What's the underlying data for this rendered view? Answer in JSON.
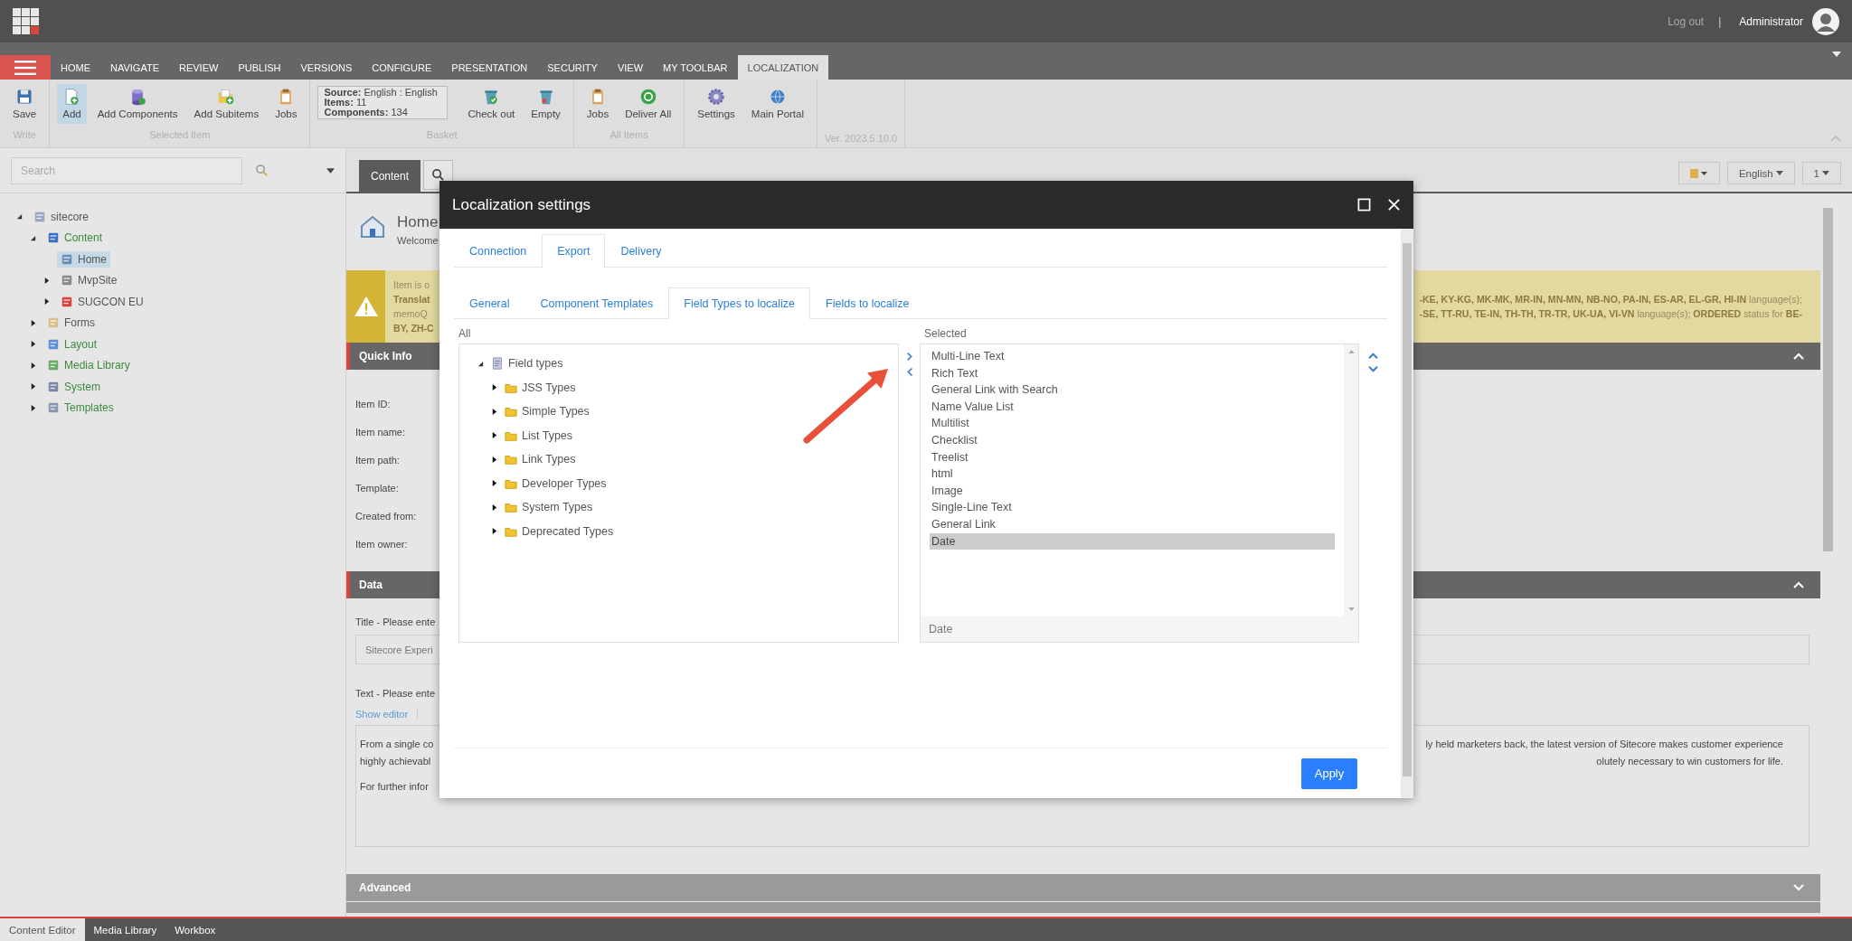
{
  "top_bar": {
    "log_out": "Log out",
    "separator": "|",
    "user": "Administrator"
  },
  "ribbon_tabs": [
    {
      "label": "HOME",
      "selected": false
    },
    {
      "label": "NAVIGATE",
      "selected": false
    },
    {
      "label": "REVIEW",
      "selected": false
    },
    {
      "label": "PUBLISH",
      "selected": false
    },
    {
      "label": "VERSIONS",
      "selected": false
    },
    {
      "label": "CONFIGURE",
      "selected": false
    },
    {
      "label": "PRESENTATION",
      "selected": false
    },
    {
      "label": "SECURITY",
      "selected": false
    },
    {
      "label": "VIEW",
      "selected": false
    },
    {
      "label": "MY TOOLBAR",
      "selected": false
    },
    {
      "label": "LOCALIZATION",
      "selected": true
    }
  ],
  "ribbon_groups": [
    {
      "label": "Write",
      "buttons": [
        {
          "label": "Save",
          "kind": "save",
          "selected": false
        }
      ]
    },
    {
      "label": "Selected Item",
      "buttons": [
        {
          "label": "Add",
          "kind": "add",
          "selected": true
        },
        {
          "label": "Add Components",
          "kind": "components",
          "selected": false
        },
        {
          "label": "Add Subitems",
          "kind": "subitems",
          "selected": false
        },
        {
          "label": "Jobs",
          "kind": "jobs",
          "selected": false
        }
      ]
    },
    {
      "label": "Basket",
      "info": [
        "**Source:** English : English",
        "**Items:** 11",
        "**Components:** 134"
      ],
      "buttons": [
        {
          "label": "Check out",
          "kind": "checkout",
          "selected": false
        },
        {
          "label": "Empty",
          "kind": "empty",
          "selected": false
        }
      ]
    },
    {
      "label": "All Items",
      "buttons": [
        {
          "label": "Jobs",
          "kind": "jobs",
          "selected": false
        },
        {
          "label": "Deliver All",
          "kind": "deliver",
          "selected": false
        }
      ]
    },
    {
      "buttons": [
        {
          "label": "Settings",
          "kind": "settings",
          "selected": false
        },
        {
          "label": "Main Portal",
          "kind": "portal",
          "selected": false
        }
      ]
    },
    {
      "version": "Ver. 2023.5.10.0"
    }
  ],
  "search": {
    "placeholder": "Search"
  },
  "tree": [
    {
      "label": "sitecore",
      "kind": "root",
      "expanded": true,
      "selected": false,
      "color": "#555555",
      "children": [
        {
          "label": "Content",
          "kind": "content",
          "expanded": true,
          "selected": false,
          "color": "#3c8a3c",
          "children": [
            {
              "label": "Home",
              "kind": "home",
              "selected": true,
              "color": "#555555"
            },
            {
              "label": "MvpSite",
              "kind": "building",
              "expanded": false,
              "selected": false,
              "color": "#555555"
            },
            {
              "label": "SUGCON EU",
              "kind": "sugcon",
              "expanded": false,
              "selected": false,
              "color": "#555555"
            }
          ]
        },
        {
          "label": "Forms",
          "kind": "forms",
          "expanded": false,
          "selected": false,
          "color": "#555555"
        },
        {
          "label": "Layout",
          "kind": "layout",
          "expanded": false,
          "selected": false,
          "color": "#3c8a3c"
        },
        {
          "label": "Media Library",
          "kind": "media",
          "expanded": false,
          "selected": false,
          "color": "#3c8a3c"
        },
        {
          "label": "System",
          "kind": "system",
          "expanded": false,
          "selected": false,
          "color": "#3c8a3c"
        },
        {
          "label": "Templates",
          "kind": "templates",
          "expanded": false,
          "selected": false,
          "color": "#3c8a3c"
        }
      ]
    }
  ],
  "editor_tabs": [
    {
      "label": "Content",
      "selected": true
    }
  ],
  "header_buttons": [
    "English",
    "1"
  ],
  "item_header": {
    "title": "Home",
    "subtitle": "Welcome"
  },
  "warning": {
    "lines": [
      {
        "left": "Item is o"
      },
      {
        "left": "**Translat**",
        "right": "**-KE, KY-KG, MK-MK, MR-IN, MN-MN, NB-NO, PA-IN, ES-AR, EL-GR, HI-IN** language(s);"
      },
      {
        "left": "memoQ",
        "right": "**-SE, TT-RU, TE-IN, TH-TH, TR-TR, UK-UA, VI-VN** language(s); **ORDERED** status for **BE-**"
      },
      {
        "left": "**BY, ZH-C**"
      }
    ]
  },
  "quick_info": {
    "title": "Quick Info",
    "expanded": true,
    "labels": [
      "Item ID:",
      "Item name:",
      "Item path:",
      "Template:",
      "Created from:",
      "Item owner:"
    ]
  },
  "data_section": {
    "title": "Data",
    "expanded": true,
    "title_label": "Title - Please ente",
    "title_value": "Sitecore Experi",
    "text_label": "Text - Please ente",
    "show_editor": "Show editor",
    "text_lines": [
      {
        "left": "From a single co",
        "right": "ly held marketers back, the latest version of Sitecore makes customer experience"
      },
      {
        "left": "highly achievabl",
        "right": "olutely necessary to win customers for life."
      },
      {
        "left": "For further infor"
      }
    ]
  },
  "advanced": {
    "title": "Advanced",
    "expanded": false
  },
  "bottom_tabs": [
    {
      "label": "Content Editor",
      "selected": true
    },
    {
      "label": "Media Library",
      "selected": false
    },
    {
      "label": "Workbox",
      "selected": false
    }
  ],
  "dialog": {
    "title": "Localization settings",
    "tabs": [
      {
        "label": "Connection",
        "selected": false
      },
      {
        "label": "Export",
        "selected": true
      },
      {
        "label": "Delivery",
        "selected": false
      }
    ],
    "subtabs": [
      {
        "label": "General",
        "selected": false
      },
      {
        "label": "Component Templates",
        "selected": false
      },
      {
        "label": "Field Types to localize",
        "selected": true
      },
      {
        "label": "Fields to localize",
        "selected": false
      }
    ],
    "all_label": "All",
    "selected_label": "Selected",
    "field_tree": {
      "label": "Field types",
      "expanded": true,
      "children": [
        {
          "label": "JSS Types",
          "expanded": false
        },
        {
          "label": "Simple Types",
          "expanded": false
        },
        {
          "label": "List Types",
          "expanded": false
        },
        {
          "label": "Link Types",
          "expanded": false
        },
        {
          "label": "Developer Types",
          "expanded": false
        },
        {
          "label": "System Types",
          "expanded": false
        },
        {
          "label": "Deprecated Types",
          "expanded": false
        }
      ]
    },
    "selected_items": [
      {
        "label": "Multi-Line Text",
        "selected": false
      },
      {
        "label": "Rich Text",
        "selected": false
      },
      {
        "label": "General Link with Search",
        "selected": false
      },
      {
        "label": "Name Value List",
        "selected": false
      },
      {
        "label": "Multilist",
        "selected": false
      },
      {
        "label": "Checklist",
        "selected": false
      },
      {
        "label": "Treelist",
        "selected": false
      },
      {
        "label": "html",
        "selected": false
      },
      {
        "label": "Image",
        "selected": false
      },
      {
        "label": "Single-Line Text",
        "selected": false
      },
      {
        "label": "General Link",
        "selected": false
      },
      {
        "label": "Date",
        "selected": true
      }
    ],
    "footer_value": "Date",
    "apply": "Apply"
  }
}
